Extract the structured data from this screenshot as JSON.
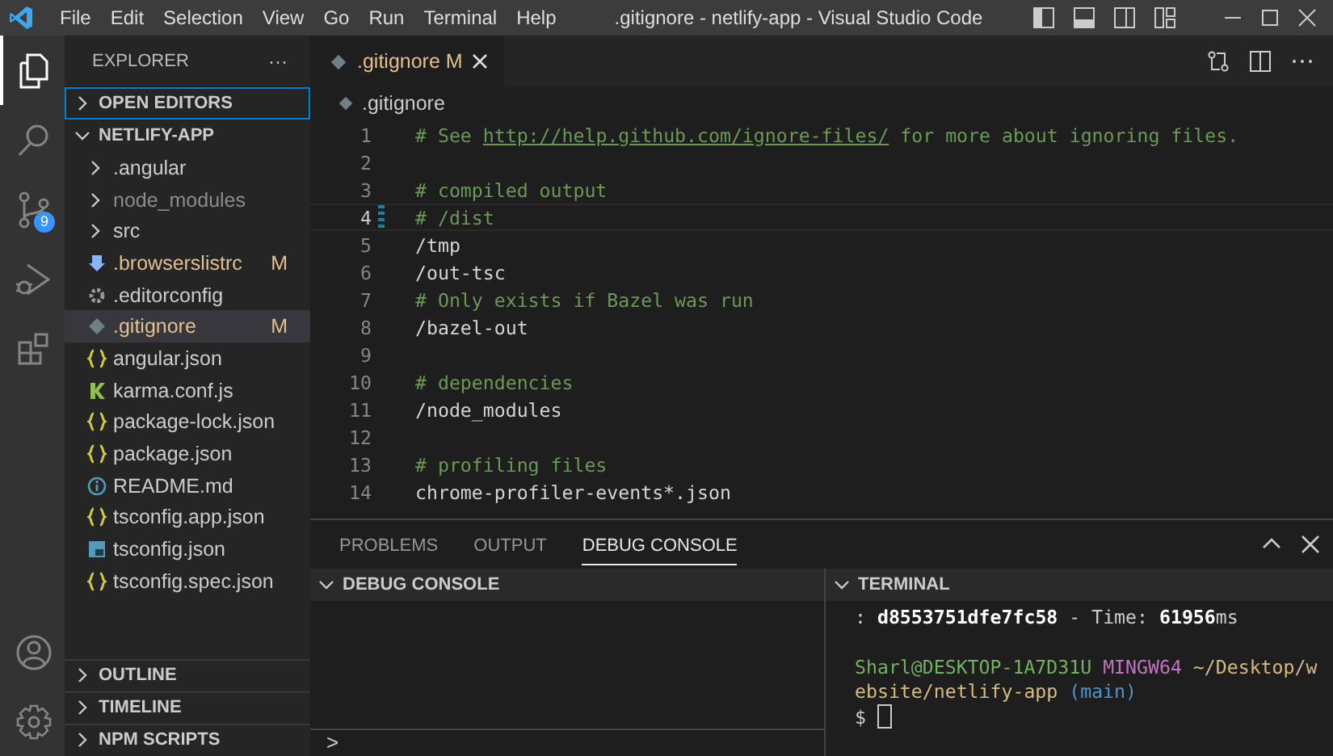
{
  "window": {
    "title": ".gitignore - netlify-app - Visual Studio Code"
  },
  "menu": [
    "File",
    "Edit",
    "Selection",
    "View",
    "Go",
    "Run",
    "Terminal",
    "Help"
  ],
  "activity_bar": [
    {
      "kind": "explorer",
      "selected": true
    },
    {
      "kind": "search",
      "selected": false
    },
    {
      "kind": "source-control",
      "selected": false,
      "badge": "9"
    },
    {
      "kind": "run-debug",
      "selected": false
    },
    {
      "kind": "extensions",
      "selected": false
    }
  ],
  "activity_bar_bottom": [
    {
      "kind": "account"
    },
    {
      "kind": "settings"
    }
  ],
  "sidebar": {
    "title": "EXPLORER",
    "more": "···",
    "sections": [
      {
        "label": "OPEN EDITORS",
        "expanded": false,
        "focused": true
      },
      {
        "label": "NETLIFY-APP",
        "expanded": true,
        "focused": false,
        "items": [
          {
            "name": ".angular",
            "kind": "folder",
            "expanded": false,
            "ignored": false,
            "selected": false
          },
          {
            "name": "node_modules",
            "kind": "folder",
            "expanded": false,
            "ignored": true,
            "selected": false
          },
          {
            "name": "src",
            "kind": "folder",
            "expanded": false,
            "ignored": false,
            "selected": false
          },
          {
            "name": ".browserslistrc",
            "kind": "browserslist",
            "status": "M",
            "ignored": false,
            "selected": false
          },
          {
            "name": ".editorconfig",
            "kind": "gear",
            "ignored": false,
            "selected": false
          },
          {
            "name": ".gitignore",
            "kind": "git",
            "status": "M",
            "ignored": false,
            "selected": true
          },
          {
            "name": "angular.json",
            "kind": "json",
            "ignored": false,
            "selected": false
          },
          {
            "name": "karma.conf.js",
            "kind": "karma",
            "ignored": false,
            "selected": false
          },
          {
            "name": "package-lock.json",
            "kind": "json",
            "ignored": false,
            "selected": false
          },
          {
            "name": "package.json",
            "kind": "json",
            "ignored": false,
            "selected": false
          },
          {
            "name": "README.md",
            "kind": "info",
            "ignored": false,
            "selected": false
          },
          {
            "name": "tsconfig.app.json",
            "kind": "json",
            "ignored": false,
            "selected": false
          },
          {
            "name": "tsconfig.json",
            "kind": "ts",
            "ignored": false,
            "selected": false
          },
          {
            "name": "tsconfig.spec.json",
            "kind": "json",
            "ignored": false,
            "selected": false
          }
        ]
      },
      {
        "label": "OUTLINE",
        "expanded": false,
        "focused": false
      },
      {
        "label": "TIMELINE",
        "expanded": false,
        "focused": false
      },
      {
        "label": "NPM SCRIPTS",
        "expanded": false,
        "focused": false
      }
    ]
  },
  "editor": {
    "tabs": [
      {
        "name": ".gitignore",
        "status": "M",
        "selected": true
      }
    ],
    "breadcrumb": ".gitignore",
    "lines": [
      {
        "number": "1",
        "current": false,
        "segments": [
          {
            "text": "# See ",
            "kind": "comment"
          },
          {
            "text": "http://help.github.com/ignore-files/",
            "kind": "link"
          },
          {
            "text": " for more about ignoring files.",
            "kind": "comment"
          }
        ]
      },
      {
        "number": "2",
        "current": false
      },
      {
        "number": "3",
        "current": false,
        "segments": [
          {
            "text": "# compiled output",
            "kind": "comment"
          }
        ]
      },
      {
        "number": "4",
        "current": true,
        "segments": [
          {
            "text": "# /dist",
            "kind": "comment"
          }
        ]
      },
      {
        "number": "5",
        "current": false,
        "segments": [
          {
            "text": "/tmp",
            "kind": "plain"
          }
        ]
      },
      {
        "number": "6",
        "current": false,
        "segments": [
          {
            "text": "/out-tsc",
            "kind": "plain"
          }
        ]
      },
      {
        "number": "7",
        "current": false,
        "segments": [
          {
            "text": "# Only exists if Bazel was run",
            "kind": "comment"
          }
        ]
      },
      {
        "number": "8",
        "current": false,
        "segments": [
          {
            "text": "/bazel-out",
            "kind": "plain"
          }
        ]
      },
      {
        "number": "9",
        "current": false
      },
      {
        "number": "10",
        "current": false,
        "segments": [
          {
            "text": "# dependencies",
            "kind": "comment"
          }
        ]
      },
      {
        "number": "11",
        "current": false,
        "segments": [
          {
            "text": "/node_modules",
            "kind": "plain"
          }
        ]
      },
      {
        "number": "12",
        "current": false
      },
      {
        "number": "13",
        "current": false,
        "segments": [
          {
            "text": "# profiling files",
            "kind": "comment"
          }
        ]
      },
      {
        "number": "14",
        "current": false,
        "segments": [
          {
            "text": "chrome-profiler-events*.json",
            "kind": "plain"
          }
        ]
      }
    ]
  },
  "panel": {
    "tabs": [
      {
        "label": "PROBLEMS",
        "selected": false
      },
      {
        "label": "OUTPUT",
        "selected": false
      },
      {
        "label": "DEBUG CONSOLE",
        "selected": true
      }
    ],
    "debug_console": {
      "title": "DEBUG CONSOLE",
      "prompt": ">"
    },
    "terminal": {
      "title": "TERMINAL",
      "lines": [
        {
          "gap_before": false,
          "segments": [
            {
              "text": ": ",
              "kind": "plain"
            },
            {
              "text": "d8553751dfe7fc58",
              "kind": "bold"
            },
            {
              "text": " - Time: ",
              "kind": "plain"
            },
            {
              "text": "61956",
              "kind": "bold"
            },
            {
              "text": "ms",
              "kind": "plain"
            }
          ]
        },
        {
          "gap_before": true,
          "segments": [
            {
              "text": "Sharl@DESKTOP-1A7D31U",
              "kind": "green"
            },
            {
              "text": " MINGW64",
              "kind": "magenta"
            },
            {
              "text": " ~/Desktop/w",
              "kind": "yellow"
            }
          ]
        },
        {
          "gap_before": false,
          "segments": [
            {
              "text": "ebsite/netlify-app",
              "kind": "yellow"
            },
            {
              "text": " (main)",
              "kind": "blue"
            }
          ]
        },
        {
          "gap_before": false,
          "segments": [
            {
              "text": "$",
              "kind": "plain"
            }
          ]
        }
      ],
      "cursor": true
    }
  }
}
